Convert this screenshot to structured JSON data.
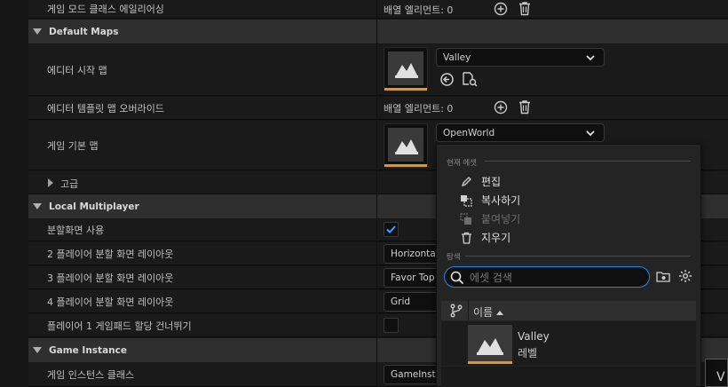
{
  "rows": {
    "game_mode_alias": {
      "label": "게임 모드 클래스 에일리어싱",
      "value": "배열 엘리먼트: 0"
    },
    "editor_startup_map": {
      "label": "에디터 시작 맵",
      "value": "Valley"
    },
    "editor_template_override": {
      "label": "에디터 템플릿 맵 오버라이드",
      "value": "배열 엘리먼트: 0"
    },
    "game_default_map": {
      "label": "게임 기본 맵",
      "value": "OpenWorld"
    },
    "advanced": {
      "label": "고급"
    },
    "split_screen": {
      "label": "분할화면 사용",
      "checked": true
    },
    "p2_layout": {
      "label": "2 플레이어 분할 화면 레이아웃",
      "value": "Horizontal"
    },
    "p3_layout": {
      "label": "3 플레이어 분할 화면 레이아웃",
      "value": "Favor Top"
    },
    "p4_layout": {
      "label": "4 플레이어 분할 화면 레이아웃",
      "value": "Grid"
    },
    "skip_gamepad": {
      "label": "플레이어 1 게임패드 할당 건너뛰기",
      "checked": false
    },
    "game_instance_class": {
      "label": "게임 인스턴스 클래스",
      "value": "GameInsta"
    }
  },
  "sections": {
    "default_maps": "Default Maps",
    "local_multiplayer": "Local Multiplayer",
    "game_instance": "Game Instance"
  },
  "popup": {
    "current_asset_header": "현재 에셋",
    "edit": "편집",
    "copy": "복사하기",
    "paste": "붙여넣기",
    "clear": "지우기",
    "browse_header": "탐색",
    "search_placeholder": "에셋 검색",
    "name_column": "이름",
    "asset_name": "Valley",
    "asset_type": "레벨"
  },
  "corner_fragment": "V",
  "colors": {
    "accent_orange": "#e8941a",
    "focus_blue": "#1f88e5",
    "check_blue": "#3ea0ff"
  }
}
